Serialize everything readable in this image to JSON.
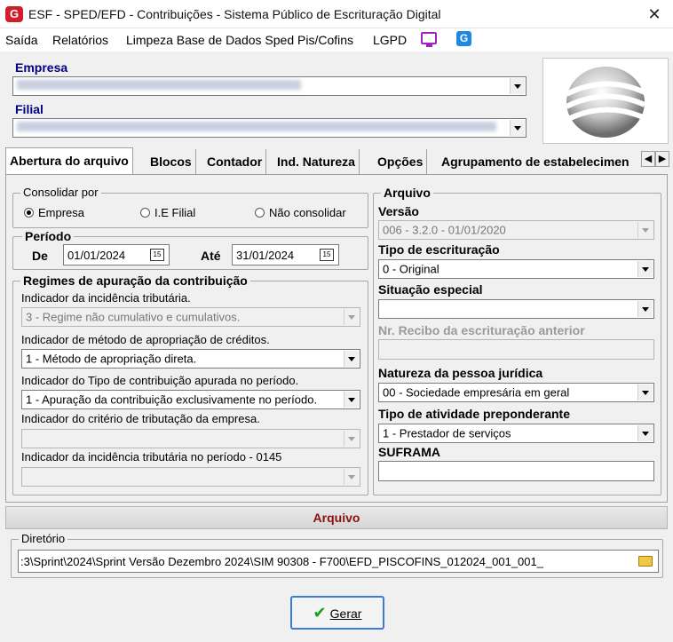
{
  "window": {
    "title": "ESF - SPED/EFD - Contribuições - Sistema Público de Escrituração Digital",
    "logo_letter": "G",
    "close_glyph": "✕"
  },
  "menu": {
    "items": [
      "Saída",
      "Relatórios",
      "Limpeza Base de Dados Sped Pis/Cofins",
      "LGPD"
    ],
    "icons": [
      "monitor-icon",
      "g-app-icon"
    ]
  },
  "empresa": {
    "label": "Empresa",
    "value": ""
  },
  "filial": {
    "label": "Filial",
    "value": ""
  },
  "tabs": [
    "Abertura do arquivo",
    "Blocos",
    "Contador",
    "Ind. Natureza",
    "Opções",
    "Agrupamento de estabelecimen"
  ],
  "tab_nav": {
    "prev": "◀",
    "next": "▶"
  },
  "consolidar": {
    "legend": "Consolidar por",
    "options": [
      "Empresa",
      "I.E Filial",
      "Não consolidar"
    ],
    "selected": 0
  },
  "periodo": {
    "legend": "Período",
    "de_label": "De",
    "de_value": "01/01/2024",
    "ate_label": "Até",
    "ate_value": "31/01/2024",
    "calendar_glyph": "15"
  },
  "regimes": {
    "legend": "Regimes de apuração da contribuição",
    "fields": [
      {
        "label": "Indicador da incidência tributária.",
        "value": "3 - Regime não cumulativo e cumulativos.",
        "disabled": true
      },
      {
        "label": "Indicador de método de apropriação de créditos.",
        "value": "1 - Método de apropriação direta.",
        "disabled": false
      },
      {
        "label": "Indicador do Tipo de contribuição apurada no período.",
        "value": "1 - Apuração da contribuição exclusivamente no período.",
        "disabled": false
      },
      {
        "label": "Indicador do critério de tributação da empresa.",
        "value": "",
        "disabled": true
      },
      {
        "label": "Indicador da incidência tributária no período  - 0145",
        "value": "",
        "disabled": true
      }
    ]
  },
  "arquivo_group": {
    "legend": "Arquivo",
    "versao_label": "Versão",
    "versao_value": "006 - 3.2.0 - 01/01/2020",
    "tipo_escrituracao_label": "Tipo de escrituração",
    "tipo_escrituracao_value": "0 - Original",
    "situacao_label": "Situação especial",
    "situacao_value": "",
    "recibo_label": "Nr. Recibo da escrituração anterior",
    "recibo_value": "",
    "natureza_label": "Natureza da pessoa jurídica",
    "natureza_value": "00 - Sociedade empresária em geral",
    "atividade_label": "Tipo de atividade preponderante",
    "atividade_value": "1 - Prestador de serviços",
    "suframa_label": "SUFRAMA",
    "suframa_value": ""
  },
  "arquivo_section": {
    "title": "Arquivo"
  },
  "diretorio": {
    "legend": "Diretório",
    "value": ":3\\Sprint\\2024\\Sprint Versão Dezembro 2024\\SIM 90308 - F700\\EFD_PISCOFINS_012024_001_001_"
  },
  "gerar": {
    "label": "Gerar"
  },
  "colors": {
    "label_blue": "#000080",
    "section_red": "#8b1010",
    "button_border": "#3a7bd5",
    "check_green": "#18a018"
  }
}
